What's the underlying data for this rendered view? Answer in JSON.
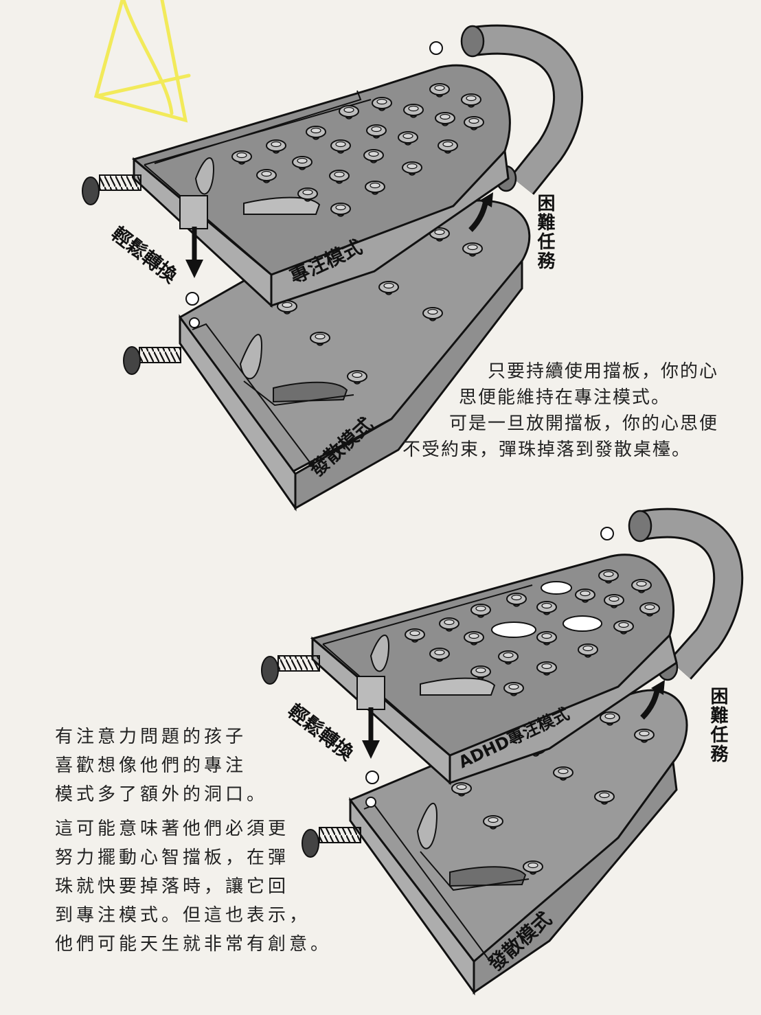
{
  "diagram1": {
    "upper_board_label": "專注模式",
    "lower_board_label": "發散模式",
    "switch_label": "輕鬆轉換",
    "hard_task_label": "困難任務"
  },
  "diagram2": {
    "upper_board_label": "ADHD專注模式",
    "lower_board_label": "發散模式",
    "switch_label": "輕鬆轉換",
    "hard_task_label": "困難任務"
  },
  "caption1": {
    "lines": [
      "只要持續使用擋板，你的心",
      "思便能維持在專注模式。",
      "可是一旦放開擋板，你的心思便",
      "不受約束，彈珠掉落到發散桌檯。"
    ]
  },
  "caption2": {
    "lines": [
      "有注意力問題的孩子",
      "喜歡想像他們的專注",
      "模式多了額外的洞口。",
      "這可能意味著他們必須更",
      "努力擺動心智擋板，在彈",
      "珠就快要掉落時，讓它回",
      "到專注模式。但這也表示，",
      "他們可能天生就非常有創意。"
    ]
  },
  "colors": {
    "paper": "#f3f1ec",
    "board_fill": "#8e8e8e",
    "board_side": "#a9a9a9",
    "ink": "#111111",
    "highlighter": "#f2e94a"
  }
}
